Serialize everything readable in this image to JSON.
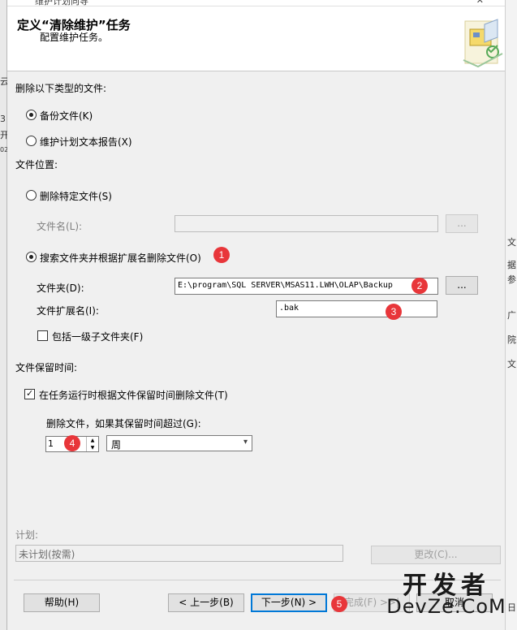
{
  "background": {
    "left_fragments": [
      "云",
      "3",
      "开",
      "02"
    ],
    "right_fragments": [
      "文",
      "据",
      "参",
      "广",
      "院",
      "文",
      "日"
    ],
    "title_fragment": "维护计划向导"
  },
  "header": {
    "title": "定义“清除维护”任务",
    "subtitle": "配置维护任务。"
  },
  "delete_type": {
    "label": "删除以下类型的文件:",
    "option_backup": "备份文件(K)",
    "option_report": "维护计划文本报告(X)"
  },
  "file_location": {
    "label": "文件位置:",
    "option_specific": "删除特定文件(S)",
    "file_name_label": "文件名(L):",
    "file_name_value": "",
    "browse_label": "...",
    "option_search": "搜索文件夹并根据扩展名删除文件(O)",
    "folder_label": "文件夹(D):",
    "folder_value": "E:\\program\\SQL SERVER\\MSAS11.LWH\\OLAP\\Backup",
    "extension_label": "文件扩展名(I):",
    "extension_value": ".bak",
    "include_subfolders": "包括一级子文件夹(F)"
  },
  "retention": {
    "label": "文件保留时间:",
    "checkbox_label": "在任务运行时根据文件保留时间删除文件(T)",
    "older_than_label": "删除文件，如果其保留时间超过(G):",
    "amount": "1",
    "unit": "周"
  },
  "schedule": {
    "label": "计划:",
    "value": "未计划(按需)",
    "change_button": "更改(C)..."
  },
  "footer": {
    "help": "帮助(H)",
    "back": "< 上一步(B)",
    "next": "下一步(N) >",
    "finish": "完成(F) >>|",
    "cancel": "取消"
  },
  "annotations": [
    "1",
    "2",
    "3",
    "4",
    "5"
  ],
  "watermark": {
    "line1": "开发者",
    "line2": "DevZe.CoM"
  },
  "colors": {
    "badge": "#e8363a",
    "primary_border": "#0078d7"
  }
}
